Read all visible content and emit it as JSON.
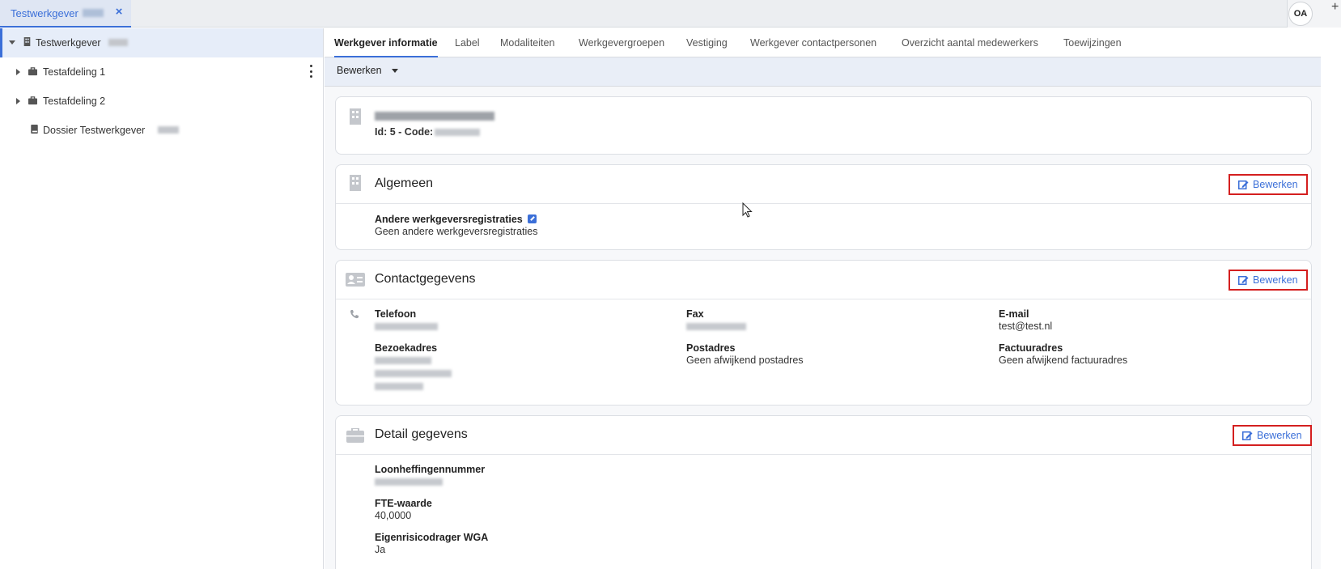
{
  "top_tab": {
    "label": "Testwerkgever",
    "close": "×"
  },
  "user": {
    "initials": "OA",
    "add": "+"
  },
  "sidebar": {
    "items": [
      {
        "label": "Testwerkgever"
      },
      {
        "label": "Testafdeling 1"
      },
      {
        "label": "Testafdeling 2"
      },
      {
        "label": "Dossier Testwerkgever"
      }
    ]
  },
  "tabs": [
    {
      "label": "Werkgever informatie"
    },
    {
      "label": "Label"
    },
    {
      "label": "Modaliteiten"
    },
    {
      "label": "Werkgevergroepen"
    },
    {
      "label": "Vestiging"
    },
    {
      "label": "Werkgever contactpersonen"
    },
    {
      "label": "Overzicht aantal medewerkers"
    },
    {
      "label": "Toewijzingen"
    }
  ],
  "toolbar": {
    "edit_label": "Bewerken"
  },
  "summary": {
    "id_code": "Id: 5 - Code:"
  },
  "algemeen": {
    "title": "Algemeen",
    "edit": "Bewerken",
    "field_label": "Andere werkgeversregistraties",
    "field_value": "Geen andere werkgeversregistraties"
  },
  "contact": {
    "title": "Contactgegevens",
    "edit": "Bewerken",
    "telefoon_label": "Telefoon",
    "fax_label": "Fax",
    "email_label": "E-mail",
    "email_value": "test@test.nl",
    "bezoek_label": "Bezoekadres",
    "post_label": "Postadres",
    "post_value": "Geen afwijkend postadres",
    "factuur_label": "Factuuradres",
    "factuur_value": "Geen afwijkend factuuradres"
  },
  "detail": {
    "title": "Detail gegevens",
    "edit": "Bewerken",
    "loon_label": "Loonheffingennummer",
    "fte_label": "FTE-waarde",
    "fte_value": "40,0000",
    "wga_label": "Eigenrisicodrager WGA",
    "wga_value": "Ja"
  },
  "colors": {
    "accent": "#3b6fd8",
    "highlight": "#d41f1f"
  }
}
